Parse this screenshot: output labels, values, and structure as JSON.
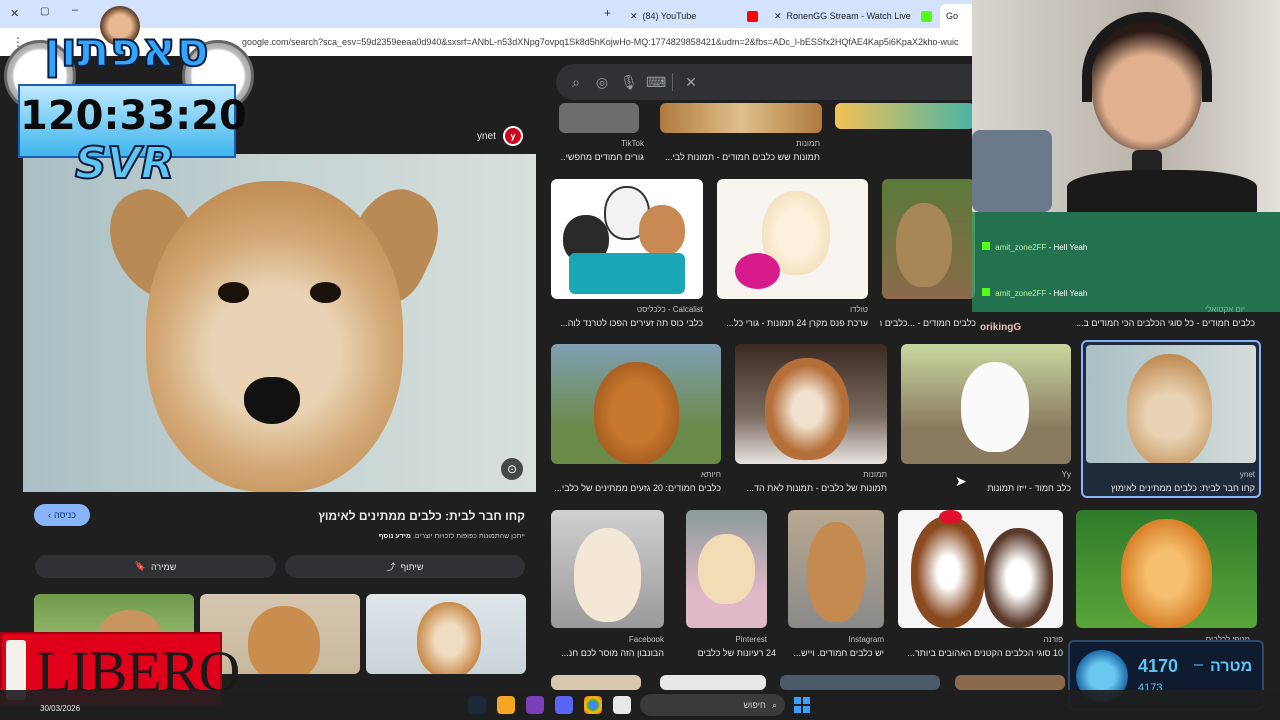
{
  "browser": {
    "tabs": [
      {
        "label": "(84) YouTube",
        "icon": "youtube-icon"
      },
      {
        "label": "RonenGG Stream - Watch Live",
        "icon": "kick-icon"
      },
      {
        "label": "Go",
        "icon": "google-icon"
      }
    ],
    "url": "google.com/search?sca_esv=59d2359eeaa0d940&sxsrf=ANbL-n53dXNpg7ovpq1Sk8d5hKojwHo-MQ:1774829858421&udm=2&fbs=ADc_l-bESSfx2HQfAE4Kap5i6KpaX2kho-wuic"
  },
  "viewer": {
    "source_name": "ynet",
    "source_badge": "y",
    "title": "קחו חבר לבית: כלבים ממתינים לאימוץ",
    "notice": "ייתכן שהתמונות כפופות לזכויות יוצרים.",
    "notice_link": "מידע נוסף",
    "visit_button": "כניסה",
    "share_button": "שיתוף",
    "save_button": "שמירה"
  },
  "results_row0": [
    {
      "source": "TikTok",
      "caption": "גורים חמודים מחפשי..."
    },
    {
      "source": "תמונות",
      "caption": "תמונות שש כלבים חמודים - תמונות לבי..."
    }
  ],
  "results_row1": [
    {
      "source": "Calcalist - כלכליסט",
      "caption": "כלבי כוס תה זעירים הפכו לטרנד לוה..."
    },
    {
      "source": "טולדו",
      "caption": "ערכת פנס מקרן 24 תמונות - גורי כל..."
    },
    {
      "source": "יום אקטואלי",
      "caption": "כלבים חמודים - כל סוגי הכלבים הכי חמודים ב..."
    },
    {
      "source": "",
      "caption": "כלבים חמודים - ...כלבים הכי חמודים ב24..."
    }
  ],
  "results_row2": [
    {
      "source": "חיותא",
      "caption": "כלבים חמודים: 20 גזעים ממתינים של כלבי..."
    },
    {
      "source": "תמונות",
      "caption": "תמונות של כלבים - תמונות לאת הד..."
    },
    {
      "source": "Yy",
      "caption": "כלב חמוד - ייזו תמונות"
    },
    {
      "source": "ynet",
      "caption": "קחו חבר לבית: כלבים ממתינים לאימוץ"
    }
  ],
  "results_row3": [
    {
      "source": "Facebook",
      "caption": "הבונבון הזה מוסר לכם חנ..."
    },
    {
      "source": "Pinterest",
      "caption": "24 רעיונות של כלבים"
    },
    {
      "source": "Instagram",
      "caption": "יש כלבים חמודים. וייש..."
    },
    {
      "source": "פורנה",
      "caption": "10 סוגי הכלבים הקטנים האהובים ביותר..."
    },
    {
      "source": "מטפי לכלבים",
      "caption": ""
    }
  ],
  "overlay": {
    "timer": "120:33:20",
    "svr": "SVR",
    "channel_logo": "סאפתון",
    "libero": "LIBERO",
    "goal_label": "מטרה",
    "goal_value": "4170",
    "goal_sub": "4173",
    "date": "30/03/2026",
    "watermark": "orikingG"
  },
  "chat": {
    "messages": [
      {
        "user": "amit_zone2FF",
        "text": "Hell Yeah"
      },
      {
        "user": "amit_zone2FF",
        "text": "Hell Yeah"
      }
    ]
  },
  "taskbar": {
    "search_placeholder": "חיפוש"
  },
  "colors": {
    "google_dark": "#1f1f1f",
    "chrome_tab": "#d3e3fd",
    "accent_blue": "#8ab4f8",
    "kick_green": "#53fc18",
    "libero_red": "#e0001b"
  }
}
